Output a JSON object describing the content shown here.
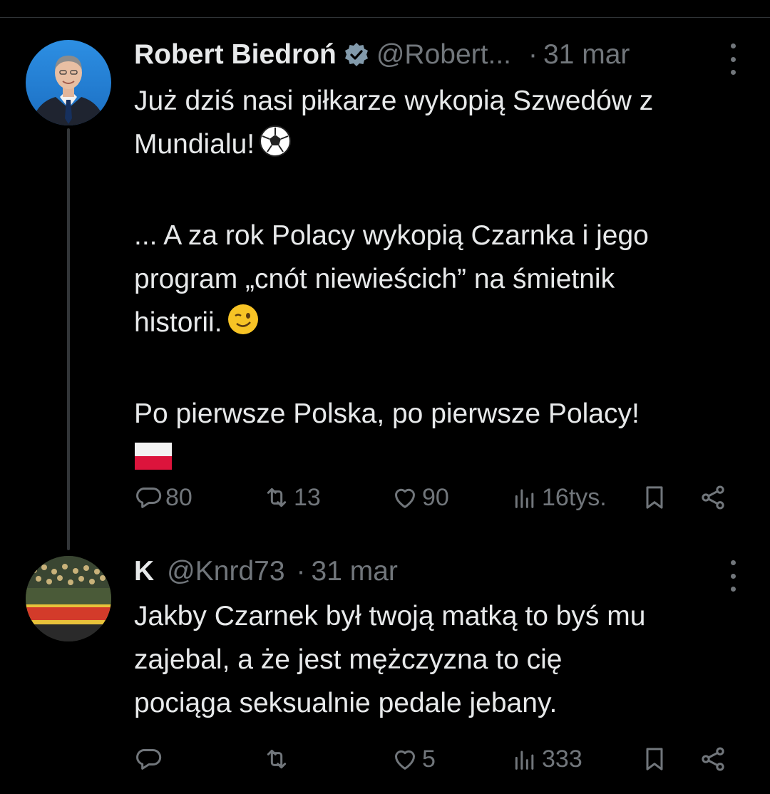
{
  "tweets": [
    {
      "author_name": "Robert Biedroń",
      "handle": "@Robert...",
      "separator": "·",
      "date": "31 mar",
      "verified": true,
      "lines": [
        "Już dziś nasi piłkarze wykopią Szwedów z",
        "Mundialu!",
        "",
        "... A za rok Polacy wykopią Czarnka i jego",
        "program „cnót niewieścich” na śmietnik",
        "historii.",
        "",
        "Po pierwsze Polska, po pierwsze Polacy!"
      ],
      "emojis": [
        "soccer-ball",
        "winking-face",
        "poland-flag"
      ],
      "stats": {
        "replies": "80",
        "retweets": "13",
        "likes": "90",
        "views": "16tys."
      }
    },
    {
      "author_name": "K",
      "handle": "@Knrd73",
      "separator": "·",
      "date": "31 mar",
      "verified": false,
      "lines": [
        "Jakby Czarnek był twoją matką to byś mu",
        "zajebal, a że jest mężczyzna to cię",
        "pociąga seksualnie pedale jebany."
      ],
      "stats": {
        "replies": "",
        "retweets": "",
        "likes": "5",
        "views": "333"
      }
    }
  ],
  "colors": {
    "background": "#000000",
    "text": "#e7e9ea",
    "secondary": "#71767b",
    "verified_badge": "#829aab",
    "thread_line": "#333639"
  }
}
